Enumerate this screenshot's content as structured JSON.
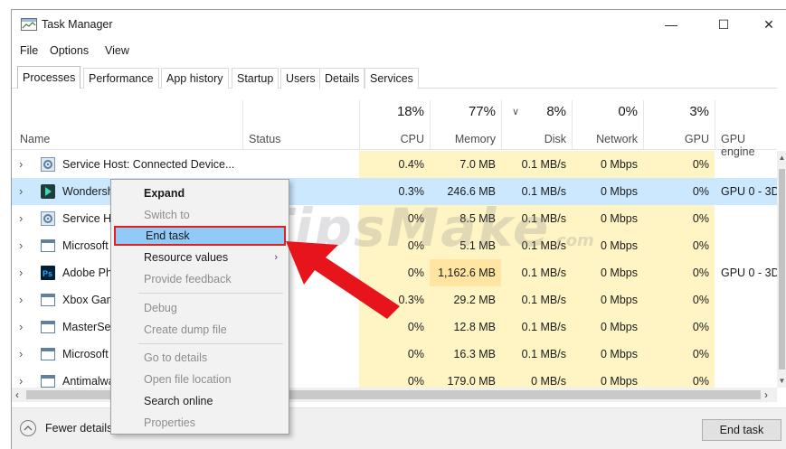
{
  "window": {
    "title": "Task Manager",
    "minimize": "—",
    "maximize": "☐",
    "close": "✕"
  },
  "menu": [
    "File",
    "Options",
    "View"
  ],
  "tabs": [
    "Processes",
    "Performance",
    "App history",
    "Startup",
    "Users",
    "Details",
    "Services"
  ],
  "columns": {
    "name": "Name",
    "status": "Status",
    "cpu": {
      "pct": "18%",
      "label": "CPU"
    },
    "memory": {
      "pct": "77%",
      "label": "Memory"
    },
    "disk": {
      "pct": "8%",
      "label": "Disk"
    },
    "network": {
      "pct": "0%",
      "label": "Network"
    },
    "gpu": {
      "pct": "3%",
      "label": "GPU"
    },
    "gpu_engine": "GPU engine"
  },
  "processes": [
    {
      "name": "Service Host: Connected Device...",
      "icon": "gear-icon",
      "cpu": "0.4%",
      "memory": "7.0 MB",
      "disk": "0.1 MB/s",
      "network": "0 Mbps",
      "gpu": "0%",
      "gpu_engine": ""
    },
    {
      "name": "Wondershare Filmora 9 (2)",
      "icon": "filmora-icon",
      "cpu": "0.3%",
      "memory": "246.6 MB",
      "disk": "0.1 MB/s",
      "network": "0 Mbps",
      "gpu": "0%",
      "gpu_engine": "GPU 0 - 3D"
    },
    {
      "name": "Service Host: ...",
      "icon": "gear-icon",
      "cpu": "0%",
      "memory": "8.5 MB",
      "disk": "0.1 MB/s",
      "network": "0 Mbps",
      "gpu": "0%",
      "gpu_engine": ""
    },
    {
      "name": "Microsoft ...",
      "icon": "window-icon",
      "cpu": "0%",
      "memory": "5.1 MB",
      "disk": "0.1 MB/s",
      "network": "0 Mbps",
      "gpu": "0%",
      "gpu_engine": ""
    },
    {
      "name": "Adobe Photoshop",
      "icon": "photoshop-icon",
      "cpu": "0%",
      "memory": "1,162.6 MB",
      "disk": "0.1 MB/s",
      "network": "0 Mbps",
      "gpu": "0%",
      "gpu_engine": "GPU 0 - 3D"
    },
    {
      "name": "Xbox Game Bar",
      "icon": "window-icon",
      "cpu": "0.3%",
      "memory": "29.2 MB",
      "disk": "0.1 MB/s",
      "network": "0 Mbps",
      "gpu": "0%",
      "gpu_engine": ""
    },
    {
      "name": "MasterSearch",
      "icon": "window-icon",
      "cpu": "0%",
      "memory": "12.8 MB",
      "disk": "0.1 MB/s",
      "network": "0 Mbps",
      "gpu": "0%",
      "gpu_engine": ""
    },
    {
      "name": "Microsoft ...",
      "icon": "window-icon",
      "cpu": "0%",
      "memory": "16.3 MB",
      "disk": "0.1 MB/s",
      "network": "0 Mbps",
      "gpu": "0%",
      "gpu_engine": ""
    },
    {
      "name": "Antimalware ...",
      "icon": "window-icon",
      "cpu": "0%",
      "memory": "179.0 MB",
      "disk": "0 MB/s",
      "network": "0 Mbps",
      "gpu": "0%",
      "gpu_engine": ""
    }
  ],
  "context_menu": {
    "expand": "Expand",
    "switch_to": "Switch to",
    "end_task": "End task",
    "resource_values": "Resource values",
    "provide_feedback": "Provide feedback",
    "debug": "Debug",
    "create_dump_file": "Create dump file",
    "go_to_details": "Go to details",
    "open_file_location": "Open file location",
    "search_online": "Search online",
    "properties": "Properties"
  },
  "footer": {
    "fewer_details": "Fewer details",
    "end_task": "End task"
  },
  "watermark": {
    "main": "TipsMake",
    "suffix": ".com"
  },
  "colors": {
    "selected_row": "#cce8ff",
    "heat_light": "#fff4c4",
    "heat_strong": "#ffe5a1",
    "arrow": "#e8141b",
    "highlight": "#91c9f7"
  }
}
